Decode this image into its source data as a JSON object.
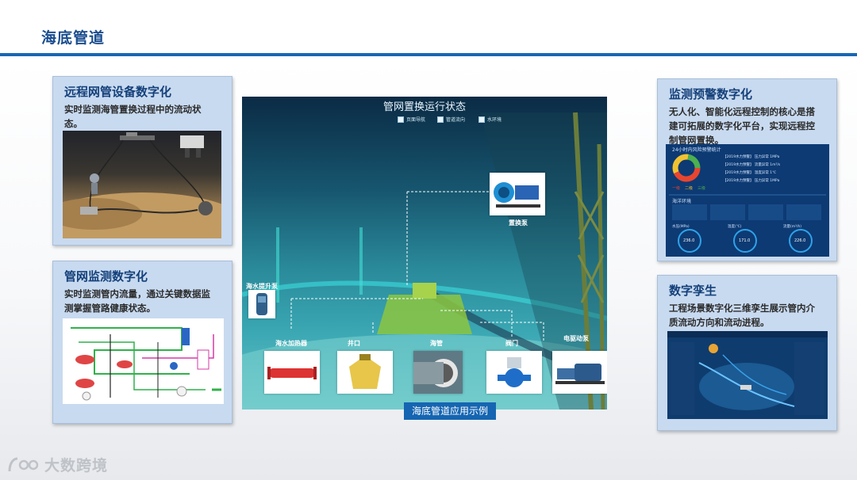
{
  "page": {
    "title": "海底管道"
  },
  "cards": {
    "remote": {
      "title": "远程网管设备数字化",
      "desc_line1": "实时监测海管置换过程中的流动状",
      "desc_line2": "态。"
    },
    "network": {
      "title": "管网监测数字化",
      "desc_line1": "实时监测管内流量，通过关键数据监",
      "desc_line2": "测掌握管路健康状态。"
    },
    "warning": {
      "title": "监测预警数字化",
      "desc_line1": "无人化、智能化远程控制的核心是搭",
      "desc_line2": "建可拓展的数字化平台，实现远程控",
      "desc_line3": "制管网置换。"
    },
    "twin": {
      "title": "数字孪生",
      "desc_line1": "工程场景数字化三维孪生展示管内介",
      "desc_line2": "质流动方向和流动进程。"
    }
  },
  "dashboard": {
    "header": "24小时内风险预警统计",
    "env_label": "海洋环境",
    "rows": [
      "【2019水力预警】 压力异常 1MPa",
      "【2019水力预警】 流量异常 1m³/s",
      "【2019水力预警】 温度异常 1℃",
      "【2019水力预警】 压力异常 1MPa"
    ],
    "legend": [
      "一级",
      "二级",
      "三级"
    ],
    "gauges": [
      {
        "label": "水压(MPa)",
        "value": "236.0"
      },
      {
        "label": "温度(℃)",
        "value": "171.0"
      },
      {
        "label": "流量(m³/h)",
        "value": "226.0"
      }
    ],
    "colors": {
      "level1": "#e8452f",
      "level2": "#f2c230",
      "level3": "#4caf50"
    }
  },
  "scene": {
    "title": "管网置换运行状态",
    "checkboxes": [
      "页面导航",
      "管道流向",
      "水环境"
    ],
    "labels": {
      "pump_top": "置换泵",
      "lift_pump": "海水提升泵",
      "heater": "海水加热器",
      "wellhead": "井口",
      "pipe": "海管",
      "valve": "阀门",
      "motor_pump": "电驱动泵"
    },
    "caption": "海底管道应用示例"
  },
  "logo": {
    "text": "大数跨境"
  }
}
